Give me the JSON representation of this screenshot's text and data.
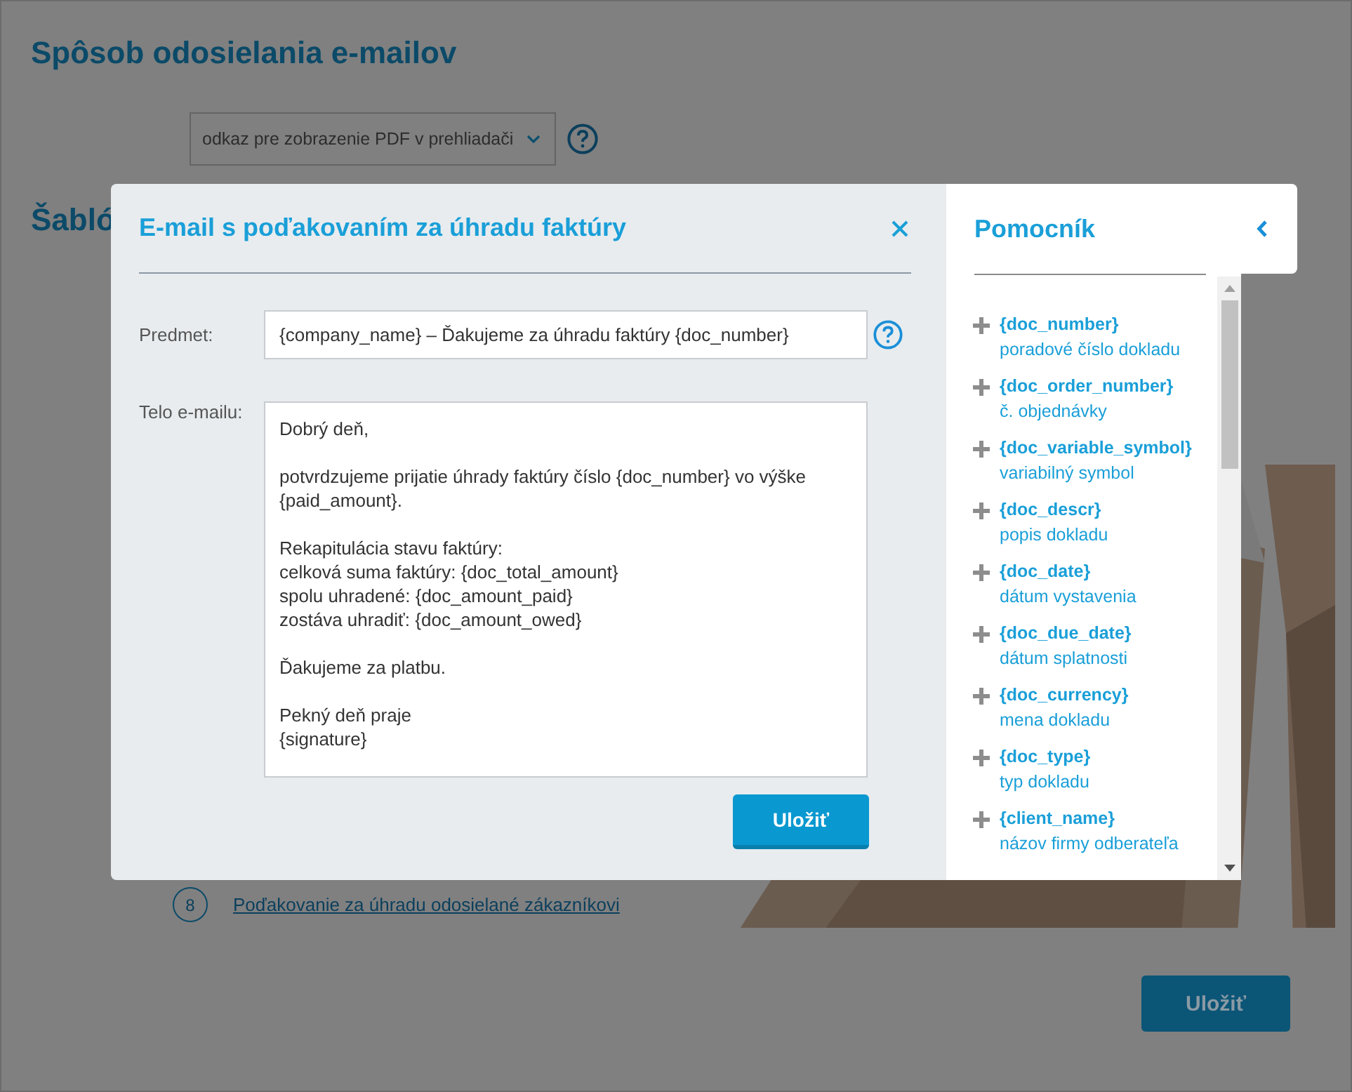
{
  "page": {
    "title": "Spôsob odosielania e-mailov",
    "send_mode_select": {
      "value": "odkaz pre zobrazenie PDF v prehliadači"
    },
    "section_title": "Šabló",
    "template_link": {
      "number": "8",
      "label": "Poďakovanie za úhradu odosielané zákazníkovi"
    },
    "save_button": "Uložiť"
  },
  "dialog": {
    "title": "E-mail s poďakovaním za úhradu faktúry",
    "subject": {
      "label": "Predmet:",
      "value": "{company_name} – Ďakujeme za úhradu faktúry {doc_number}"
    },
    "body": {
      "label": "Telo e-mailu:",
      "value": "Dobrý deň,\n\npotvrdzujeme prijatie úhrady faktúry číslo {doc_number} vo výške\n{paid_amount}.\n\nRekapitulácia stavu faktúry:\ncelková suma faktúry: {doc_total_amount}\nspolu uhradené: {doc_amount_paid}\nzostáva uhradiť: {doc_amount_owed}\n\nĎakujeme za platbu.\n\nPekný deň praje\n{signature}"
    },
    "save_button": "Uložiť"
  },
  "helper": {
    "title": "Pomocník",
    "items": [
      {
        "placeholder": "{doc_number}",
        "description": "poradové číslo dokladu"
      },
      {
        "placeholder": "{doc_order_number}",
        "description": "č. objednávky"
      },
      {
        "placeholder": "{doc_variable_symbol}",
        "description": "variabilný symbol"
      },
      {
        "placeholder": "{doc_descr}",
        "description": "popis dokladu"
      },
      {
        "placeholder": "{doc_date}",
        "description": "dátum vystavenia"
      },
      {
        "placeholder": "{doc_due_date}",
        "description": "dátum splatnosti"
      },
      {
        "placeholder": "{doc_currency}",
        "description": "mena dokladu"
      },
      {
        "placeholder": "{doc_type}",
        "description": "typ dokladu"
      },
      {
        "placeholder": "{client_name}",
        "description": "názov firmy odberateľa"
      }
    ]
  }
}
